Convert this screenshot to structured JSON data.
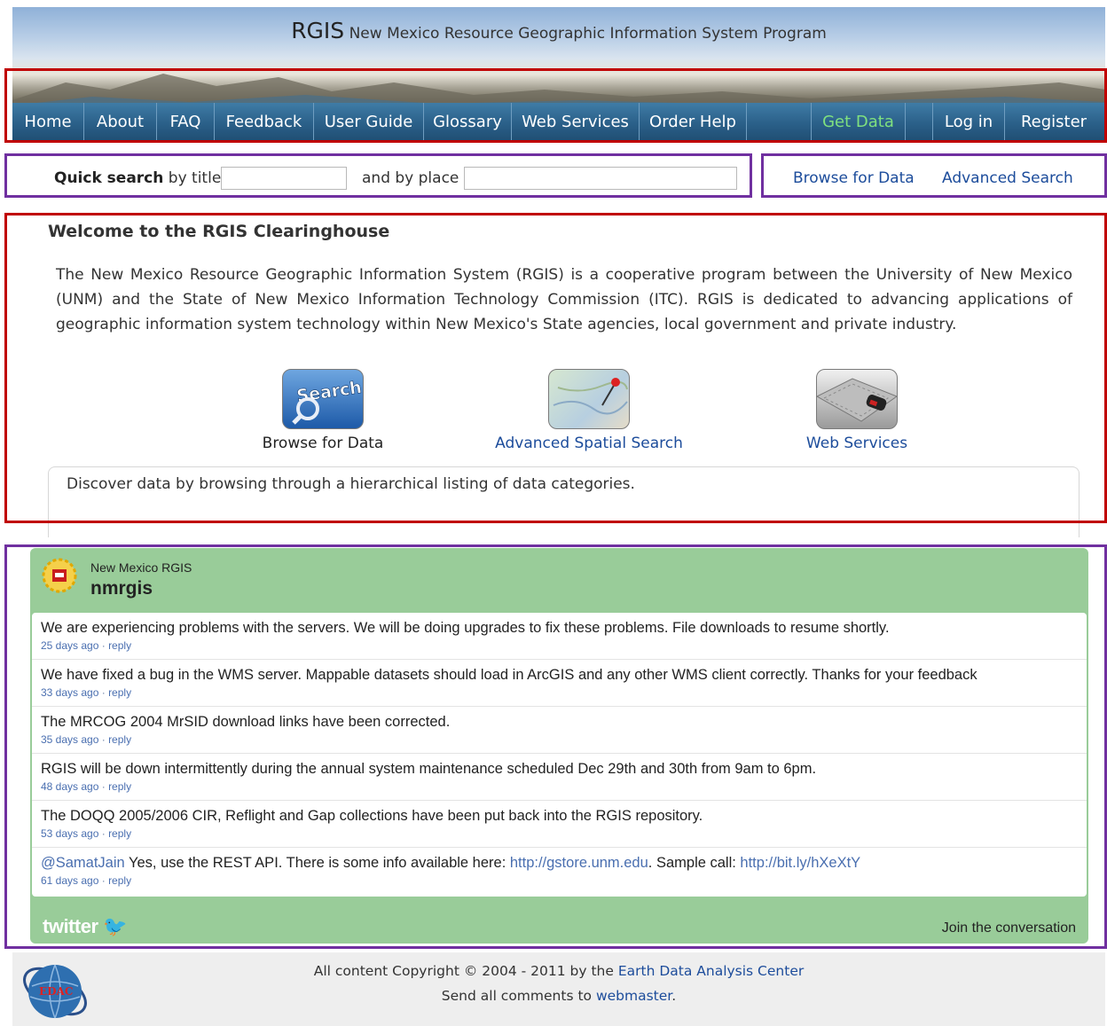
{
  "header": {
    "title_big": "RGIS",
    "title_rest": "New Mexico Resource Geographic Information System Program"
  },
  "nav": {
    "home": "Home",
    "about": "About",
    "faq": "FAQ",
    "feedback": "Feedback",
    "user_guide": "User Guide",
    "glossary": "Glossary",
    "web_services": "Web Services",
    "order_help": "Order Help",
    "get_data": "Get Data",
    "log_in": "Log in",
    "register": "Register",
    "active_color": "#7fe07f"
  },
  "search": {
    "quick_search_bold": "Quick search",
    "quick_search_rest": "by title",
    "title_value": "",
    "by_place_label": "and by place",
    "place_value": "",
    "browse_link": "Browse for Data",
    "advanced_link": "Advanced Search"
  },
  "welcome": {
    "title": "Welcome to the RGIS Clearinghouse",
    "intro": "The New Mexico Resource Geographic Information System (RGIS) is a cooperative program between the University of New Mexico (UNM) and the State of New Mexico Information Technology Commission (ITC). RGIS is dedicated to advancing applications of geographic information system technology within New Mexico's State agencies, local government and private industry.",
    "features": [
      {
        "label": "Browse for Data",
        "icon_text": "Search",
        "icon": "search-icon"
      },
      {
        "label": "Advanced Spatial Search",
        "icon": "map-pin-icon"
      },
      {
        "label": "Web Services",
        "icon": "laptop-mouse-icon"
      }
    ],
    "description": "Discover data by browsing through a hierarchical listing of data categories."
  },
  "twitter": {
    "display_name": "New Mexico RGIS",
    "handle": "nmrgis",
    "reply_label": "reply",
    "tweets": [
      {
        "text": "We are experiencing problems with the servers. We will be doing upgrades to fix these problems. File downloads to resume shortly.",
        "age": "25 days ago"
      },
      {
        "text": "We have fixed a bug in the WMS server. Mappable datasets should load in ArcGIS and any other WMS client correctly. Thanks for your feedback",
        "age": "33 days ago"
      },
      {
        "text": "The MRCOG 2004 MrSID download links have been corrected.",
        "age": "35 days ago"
      },
      {
        "text": "RGIS will be down intermittently during the annual system maintenance scheduled Dec 29th and 30th from 9am to 6pm.",
        "age": "48 days ago"
      },
      {
        "text": "The DOQQ 2005/2006 CIR, Reflight and Gap collections have been put back into the RGIS repository.",
        "age": "53 days ago"
      },
      {
        "mention": "@SamatJain",
        "text_a": " Yes, use the REST API. There is some info available here: ",
        "link1": "http://gstore.unm.edu",
        "text_b": ". Sample call: ",
        "link2": "http://bit.ly/hXeXtY",
        "age": "61 days ago"
      }
    ],
    "logo_text": "twitter",
    "join": "Join the conversation"
  },
  "footer": {
    "copyright_prefix": "All content Copyright © 2004 - 2011 by the",
    "org_link": "Earth Data Analysis Center",
    "comments_prefix": "Send all comments to",
    "webmaster_link": "webmaster",
    "comments_suffix": ".",
    "logo_text": "EDAC"
  }
}
